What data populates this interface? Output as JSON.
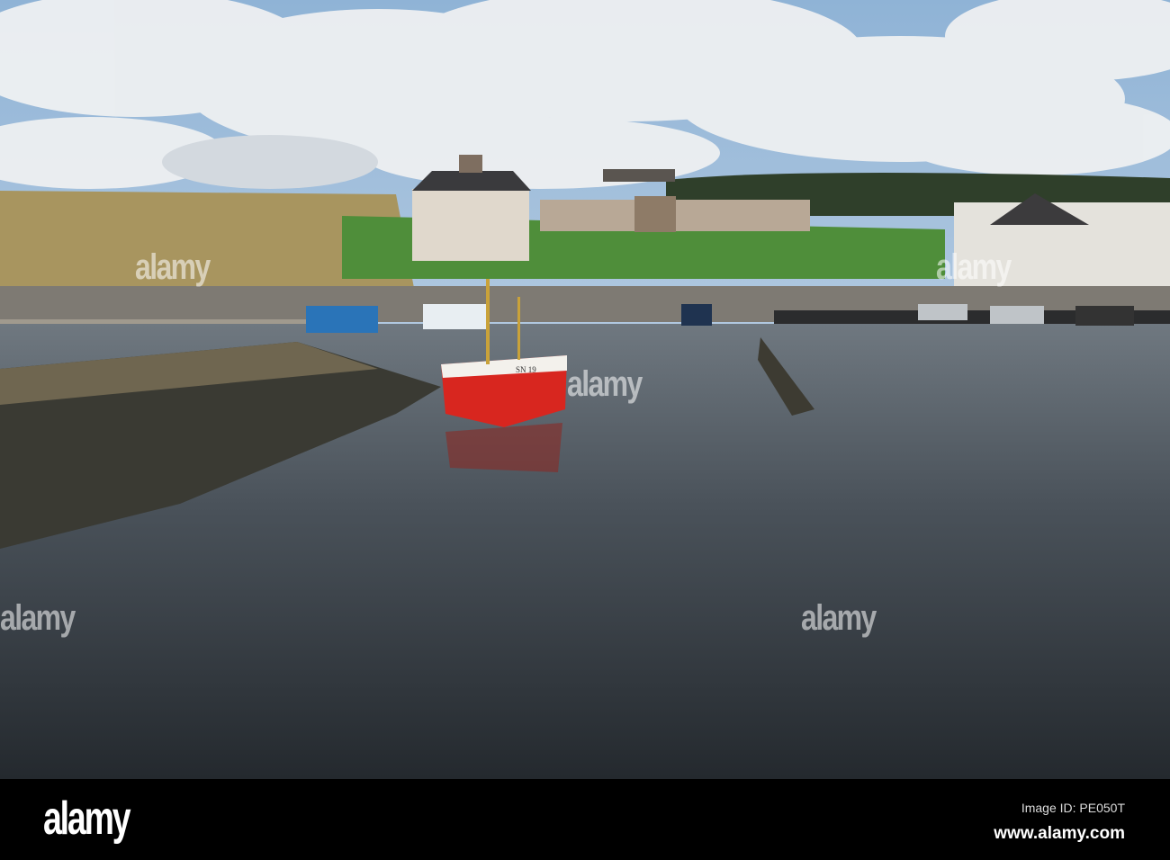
{
  "photo": {
    "boat_registration": "SN 19"
  },
  "watermark": {
    "text": "alamy",
    "mark": "a"
  },
  "footer": {
    "logo": "alamy",
    "image_id": "Image ID: PE050T",
    "website": "www.alamy.com"
  }
}
